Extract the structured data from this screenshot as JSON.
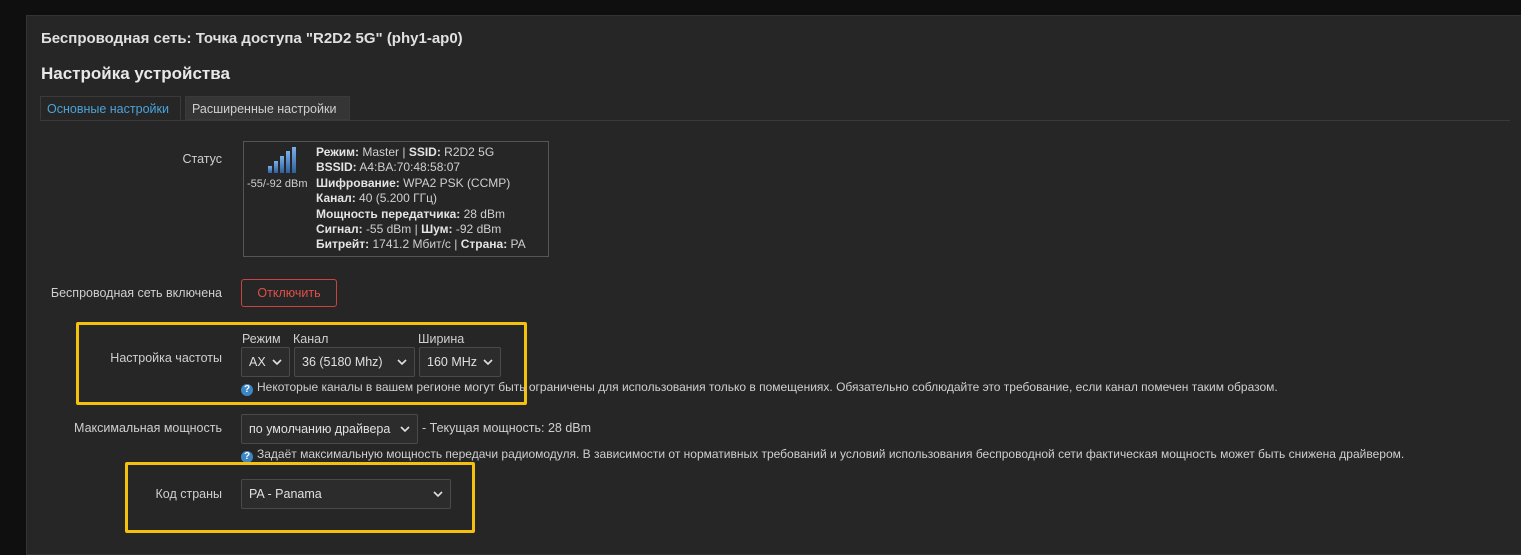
{
  "page": {
    "title": "Беспроводная сеть: Точка доступа \"R2D2 5G\" (phy1-ap0)",
    "subtitle": "Настройка устройства"
  },
  "tabs": [
    {
      "label": "Основные настройки",
      "active": true
    },
    {
      "label": "Расширенные настройки",
      "active": false
    }
  ],
  "status": {
    "label": "Статус",
    "signal_text": "-55/-92 dBm",
    "signal_icon": "signal-bars-icon",
    "mode_label": "Режим:",
    "mode_value": "Master",
    "ssid_label": "SSID:",
    "ssid_value": "R2D2 5G",
    "bssid_label": "BSSID:",
    "bssid_value": "A4:BA:70:48:58:07",
    "encryption_label": "Шифрование:",
    "encryption_value": "WPA2 PSK (CCMP)",
    "channel_label": "Канал:",
    "channel_value": "40 (5.200 ГГц)",
    "txpower_label": "Мощность передатчика:",
    "txpower_value": "28 dBm",
    "signal_label": "Сигнал:",
    "signal_value": "-55 dBm",
    "noise_label": "Шум:",
    "noise_value": "-92 dBm",
    "bitrate_label": "Битрейт:",
    "bitrate_value": "1741.2 Мбит/с",
    "country_label": "Страна:",
    "country_value": "PA"
  },
  "wireless_enabled": {
    "label": "Беспроводная сеть включена",
    "button": "Отключить"
  },
  "frequency": {
    "label": "Настройка частоты",
    "mode_header": "Режим",
    "channel_header": "Канал",
    "width_header": "Ширина",
    "mode_value": "AX",
    "channel_value": "36 (5180 Mhz)",
    "width_value": "160 MHz",
    "help": "Некоторые каналы в вашем регионе могут быть ограничены для использования только в помещениях. Обязательно соблюдайте это требование, если канал помечен таким образом."
  },
  "max_power": {
    "label": "Максимальная мощность",
    "value": "по умолчанию драйвера",
    "current": "- Текущая мощность: 28 dBm",
    "help": "Задаёт максимальную мощность передачи радиомодуля. В зависимости от нормативных требований и условий использования беспроводной сети фактическая мощность может быть снижена драйвером."
  },
  "country": {
    "label": "Код страны",
    "value": "PA - Panama"
  },
  "colors": {
    "background": "#0f0f0f",
    "panel": "#262626",
    "accent": "#4aa3d8",
    "danger": "#e0504a",
    "highlight": "#f4c20d",
    "help_icon": "#3d86c6"
  }
}
